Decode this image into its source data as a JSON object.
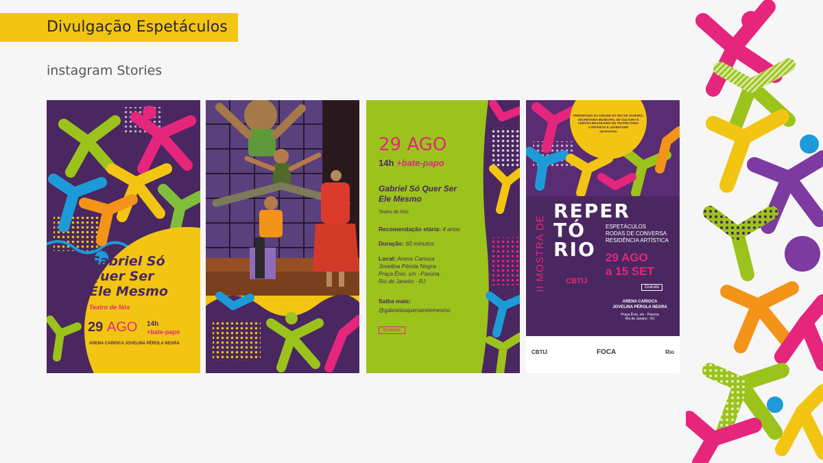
{
  "header": {
    "title": "Divulgação Espetáculos",
    "subtitle": "instagram Stories"
  },
  "colors": {
    "yellow": "#f2c512",
    "purple": "#4a2760",
    "green": "#9bc31b",
    "magenta": "#e6257d",
    "orange": "#f39418",
    "blue": "#1d9bd8"
  },
  "stories": [
    {
      "title_lines": [
        "Gabriel Só",
        "Quer Ser",
        "Ele Mesmo"
      ],
      "venue": "Teatro de Nós",
      "date_day": "29",
      "date_month": "AGO",
      "time": "14h",
      "extra": "+bate-papo",
      "location": "ARENA CARIOCA JOVELINA PÉROLA NEGRA"
    },
    {},
    {
      "date": "29 AGO",
      "time": "14h",
      "extra": "+bate-papo",
      "title_lines": [
        "Gabriel Só Quer Ser",
        "Ele Mesmo"
      ],
      "venue": "Teatro de Nós",
      "age_label": "Recomendação etária:",
      "age_value": "4 anos",
      "duration_label": "Duração:",
      "duration_value": "50 minutos",
      "local_label": "Local:",
      "local_lines": [
        "Arena Carioca",
        "Jovelina Pérola Negra"
      ],
      "address_lines": [
        "Praça Ênio, s/n - Pavuna,",
        "Rio de Janeiro - RJ"
      ],
      "more_label": "Saiba mais:",
      "handle": "@gabrielsoquerserelemesmo",
      "badge": "Gratuito"
    },
    {
      "presenter_lines": [
        "PREFEITURA DA CIDADE DO RIO DE JANEIRO,",
        "SECRETARIA MUNICIPAL DE CULTURA E",
        "CENTRO BRASILEIRO DE TEATRO PARA",
        "A INFÂNCIA E JUVENTUDE"
      ],
      "presents": "apresentam",
      "mostra": "II MOSTRA DE",
      "rep_lines": [
        "REPER",
        "TÓ",
        "RIO"
      ],
      "program_lines": [
        "ESPETÁCULOS",
        "RODAS DE CONVERSA",
        "RESIDÊNCIA ARTÍSTICA"
      ],
      "date_line1": "29 AGO",
      "date_line2": "a 15 SET",
      "badge": "Gratuito",
      "venue_lines": [
        "ARENA CARIOCA",
        "JOVELINA PÉROLA NEGRA"
      ],
      "address_lines": [
        "Praça Ênio, s/n - Pavuna",
        "Rio de Janeiro - RJ"
      ],
      "sponsors": [
        "CBTIJ",
        "FOCA",
        "Rio"
      ]
    }
  ]
}
